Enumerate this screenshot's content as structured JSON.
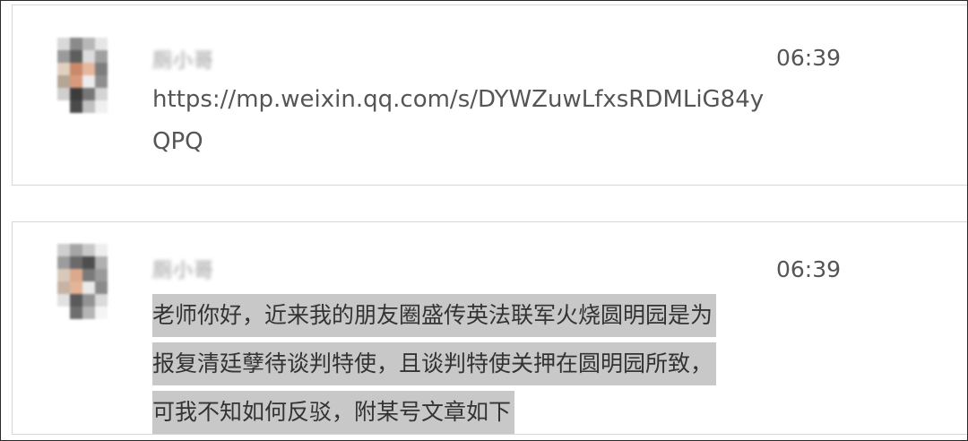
{
  "messages": [
    {
      "sender": "厕小哥",
      "time": "06:39",
      "text": "https://mp.weixin.qq.com/s/DYWZuwLfxsRDMLiG84yQPQ"
    },
    {
      "sender": "厕小哥",
      "time": "06:39",
      "lines": [
        "老师你好，近来我的朋友圈盛传英法联军火烧圆明园是为",
        "报复清廷孽待谈判特使，且谈判特使关押在圆明园所致，",
        "可我不知如何反驳，附某号文章如下"
      ]
    }
  ]
}
